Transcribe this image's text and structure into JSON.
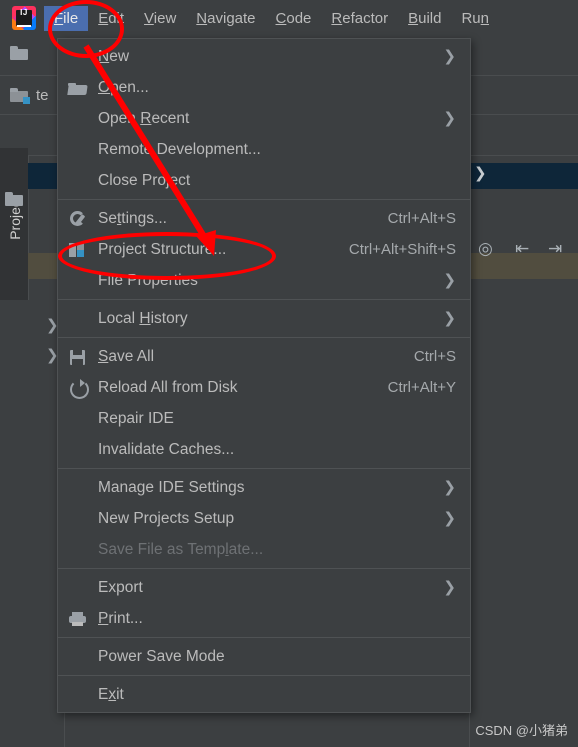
{
  "app": {
    "name": "IntelliJ IDEA",
    "logo_icon": "intellij-idea-logo-icon",
    "project_tab_label": "Project",
    "project_name_fragment": "te"
  },
  "menubar": {
    "items": [
      {
        "label": "File",
        "mnemonic": "F",
        "active": true
      },
      {
        "label": "Edit",
        "mnemonic": "E",
        "active": false
      },
      {
        "label": "View",
        "mnemonic": "V",
        "active": false
      },
      {
        "label": "Navigate",
        "mnemonic": "N",
        "active": false
      },
      {
        "label": "Code",
        "mnemonic": "C",
        "active": false
      },
      {
        "label": "Refactor",
        "mnemonic": "R",
        "active": false
      },
      {
        "label": "Build",
        "mnemonic": "B",
        "active": false
      },
      {
        "label": "Run",
        "mnemonic": "n",
        "active": false
      }
    ]
  },
  "toolbar": {
    "run_configurations_dropdown": "run-config-dropdown",
    "run_icon": "run-play-icon",
    "debug_icon": "debug-bug-icon",
    "locate_icon": "select-opened-file-icon",
    "expand_all_icon": "expand-all-icon",
    "collapse_all_icon": "collapse-all-icon"
  },
  "file_menu": {
    "groups": [
      {
        "items": [
          {
            "label": "New",
            "mnemonic": "N",
            "icon": null,
            "accel": "",
            "submenu": true,
            "disabled": false
          },
          {
            "label": "Open...",
            "mnemonic": "O",
            "icon": "open-folder-icon",
            "accel": "",
            "submenu": false,
            "disabled": false
          },
          {
            "label": "Open Recent",
            "mnemonic": "R",
            "icon": null,
            "accel": "",
            "submenu": true,
            "disabled": false
          },
          {
            "label": "Remote Development...",
            "mnemonic": "",
            "icon": null,
            "accel": "",
            "submenu": false,
            "disabled": false
          },
          {
            "label": "Close Project",
            "mnemonic": "",
            "icon": null,
            "accel": "",
            "submenu": false,
            "disabled": false
          }
        ]
      },
      {
        "items": [
          {
            "label": "Settings...",
            "mnemonic": "t",
            "icon": "wrench-icon",
            "accel": "Ctrl+Alt+S",
            "submenu": false,
            "disabled": false
          },
          {
            "label": "Project Structure...",
            "mnemonic": "",
            "icon": "project-structure-icon",
            "accel": "Ctrl+Alt+Shift+S",
            "submenu": false,
            "disabled": false
          },
          {
            "label": "File Properties",
            "mnemonic": "",
            "icon": null,
            "accel": "",
            "submenu": true,
            "disabled": false
          }
        ]
      },
      {
        "items": [
          {
            "label": "Local History",
            "mnemonic": "H",
            "icon": null,
            "accel": "",
            "submenu": true,
            "disabled": false
          }
        ]
      },
      {
        "items": [
          {
            "label": "Save All",
            "mnemonic": "S",
            "icon": "save-all-icon",
            "accel": "Ctrl+S",
            "submenu": false,
            "disabled": false
          },
          {
            "label": "Reload All from Disk",
            "mnemonic": "",
            "icon": "reload-icon",
            "accel": "Ctrl+Alt+Y",
            "submenu": false,
            "disabled": false
          },
          {
            "label": "Repair IDE",
            "mnemonic": "",
            "icon": null,
            "accel": "",
            "submenu": false,
            "disabled": false
          },
          {
            "label": "Invalidate Caches...",
            "mnemonic": "",
            "icon": null,
            "accel": "",
            "submenu": false,
            "disabled": false
          }
        ]
      },
      {
        "items": [
          {
            "label": "Manage IDE Settings",
            "mnemonic": "",
            "icon": null,
            "accel": "",
            "submenu": true,
            "disabled": false
          },
          {
            "label": "New Projects Setup",
            "mnemonic": "",
            "icon": null,
            "accel": "",
            "submenu": true,
            "disabled": false
          },
          {
            "label": "Save File as Template...",
            "mnemonic": "l",
            "icon": null,
            "accel": "",
            "submenu": false,
            "disabled": true
          }
        ]
      },
      {
        "items": [
          {
            "label": "Export",
            "mnemonic": "",
            "icon": null,
            "accel": "",
            "submenu": true,
            "disabled": false
          },
          {
            "label": "Print...",
            "mnemonic": "P",
            "icon": "print-icon",
            "accel": "",
            "submenu": false,
            "disabled": false
          }
        ]
      },
      {
        "items": [
          {
            "label": "Power Save Mode",
            "mnemonic": "",
            "icon": null,
            "accel": "",
            "submenu": false,
            "disabled": false
          }
        ]
      },
      {
        "items": [
          {
            "label": "Exit",
            "mnemonic": "x",
            "icon": null,
            "accel": "",
            "submenu": false,
            "disabled": false
          }
        ]
      }
    ]
  },
  "annotations": {
    "color": "#FF0000",
    "ellipse_file_target": "File",
    "ellipse_project_structure_target": "Project Structure...",
    "arrow_from": "File",
    "arrow_to": "Project Structure..."
  },
  "watermark": {
    "text": "CSDN @小猪弟"
  },
  "colors": {
    "menu_bg": "#3C3F41",
    "menu_border": "#4F5254",
    "text": "#BBBBBB",
    "disabled_text": "#6E7174",
    "accel_text": "#A5A9AC",
    "menubar_highlight": "#4B6EAF",
    "selected_row": "#0E2639",
    "highlighted_row": "#514D3F",
    "run_green": "#59A869",
    "annotation_red": "#FF0000"
  }
}
